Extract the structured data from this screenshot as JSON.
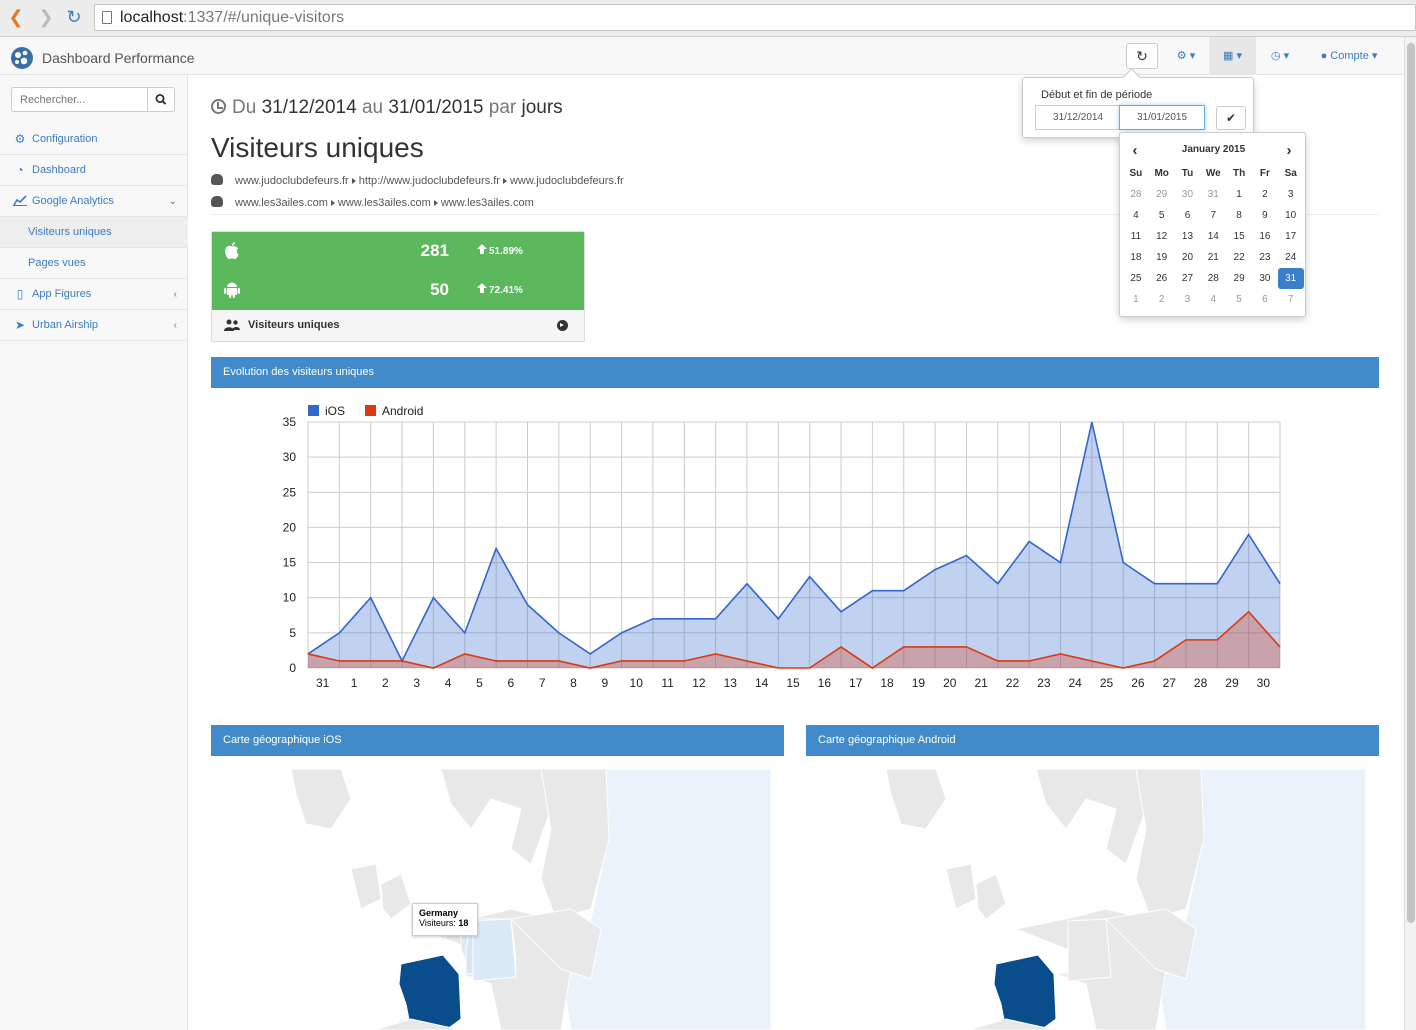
{
  "browser": {
    "url_host": "localhost",
    "url_rest": ":1337/#/unique-visitors"
  },
  "navbar": {
    "brand": "Dashboard Performance",
    "account_label": "Compte"
  },
  "sidebar": {
    "search_placeholder": "Rechercher...",
    "items": [
      {
        "label": "Configuration",
        "icon": "gear-icon"
      },
      {
        "label": "Dashboard",
        "icon": "dashboard-icon"
      },
      {
        "label": "Google Analytics",
        "icon": "line-chart-icon"
      },
      {
        "label": "Visiteurs uniques",
        "sub": true
      },
      {
        "label": "Pages vues",
        "sub": true
      },
      {
        "label": "App Figures",
        "icon": "mobile-icon"
      },
      {
        "label": "Urban Airship",
        "icon": "send-icon"
      }
    ]
  },
  "header": {
    "du": "Du",
    "start": "31/12/2014",
    "au": "au",
    "end": "31/01/2015",
    "par": "par",
    "unit": "jours",
    "title": "Visiteurs uniques",
    "ios_sources": [
      "www.judoclubdefeurs.fr",
      "http://www.judoclubdefeurs.fr",
      "www.judoclubdefeurs.fr"
    ],
    "android_sources": [
      "www.les3ailes.com",
      "www.les3ailes.com",
      "www.les3ailes.com"
    ]
  },
  "stats": {
    "ios_value": "281",
    "ios_pct": "51.89%",
    "android_value": "50",
    "android_pct": "72.41%",
    "footer": "Visiteurs uniques"
  },
  "chart_panel": {
    "title": "Evolution des visiteurs uniques"
  },
  "chart_data": {
    "type": "area",
    "x": [
      "31",
      "1",
      "2",
      "3",
      "4",
      "5",
      "6",
      "7",
      "8",
      "9",
      "10",
      "11",
      "12",
      "13",
      "14",
      "15",
      "16",
      "17",
      "18",
      "19",
      "20",
      "21",
      "22",
      "23",
      "24",
      "25",
      "26",
      "27",
      "28",
      "29",
      "30"
    ],
    "series": [
      {
        "name": "iOS",
        "color": "#3366cc",
        "values": [
          2,
          5,
          10,
          1,
          10,
          5,
          17,
          9,
          5,
          2,
          5,
          7,
          7,
          7,
          12,
          7,
          13,
          8,
          11,
          11,
          14,
          16,
          12,
          18,
          15,
          35,
          15,
          12,
          12,
          12,
          19,
          12
        ]
      },
      {
        "name": "Android",
        "color": "#dc3912",
        "values": [
          2,
          1,
          1,
          1,
          0,
          2,
          1,
          1,
          1,
          0,
          1,
          1,
          1,
          2,
          1,
          0,
          0,
          3,
          0,
          3,
          3,
          3,
          1,
          1,
          2,
          1,
          0,
          1,
          4,
          4,
          8,
          3
        ]
      }
    ],
    "ylim": [
      0,
      35
    ],
    "yticks": [
      0,
      5,
      10,
      15,
      20,
      25,
      30,
      35
    ],
    "legend": "top-left",
    "grid": true
  },
  "maps": {
    "ios_title": "Carte géographique iOS",
    "android_title": "Carte géographique Android",
    "tooltip_country": "Germany",
    "tooltip_label": "Visiteurs:",
    "tooltip_value": "18"
  },
  "date_popover": {
    "label": "Début et fin de période",
    "start_value": "31/12/2014",
    "end_value": "31/01/2015"
  },
  "datepicker": {
    "prev": "‹",
    "next": "›",
    "title": "January 2015",
    "dow": [
      "Su",
      "Mo",
      "Tu",
      "We",
      "Th",
      "Fr",
      "Sa"
    ],
    "weeks": [
      [
        "28",
        "29",
        "30",
        "31",
        "1",
        "2",
        "3"
      ],
      [
        "4",
        "5",
        "6",
        "7",
        "8",
        "9",
        "10"
      ],
      [
        "11",
        "12",
        "13",
        "14",
        "15",
        "16",
        "17"
      ],
      [
        "18",
        "19",
        "20",
        "21",
        "22",
        "23",
        "24"
      ],
      [
        "25",
        "26",
        "27",
        "28",
        "29",
        "30",
        "31"
      ],
      [
        "1",
        "2",
        "3",
        "4",
        "5",
        "6",
        "7"
      ]
    ]
  }
}
